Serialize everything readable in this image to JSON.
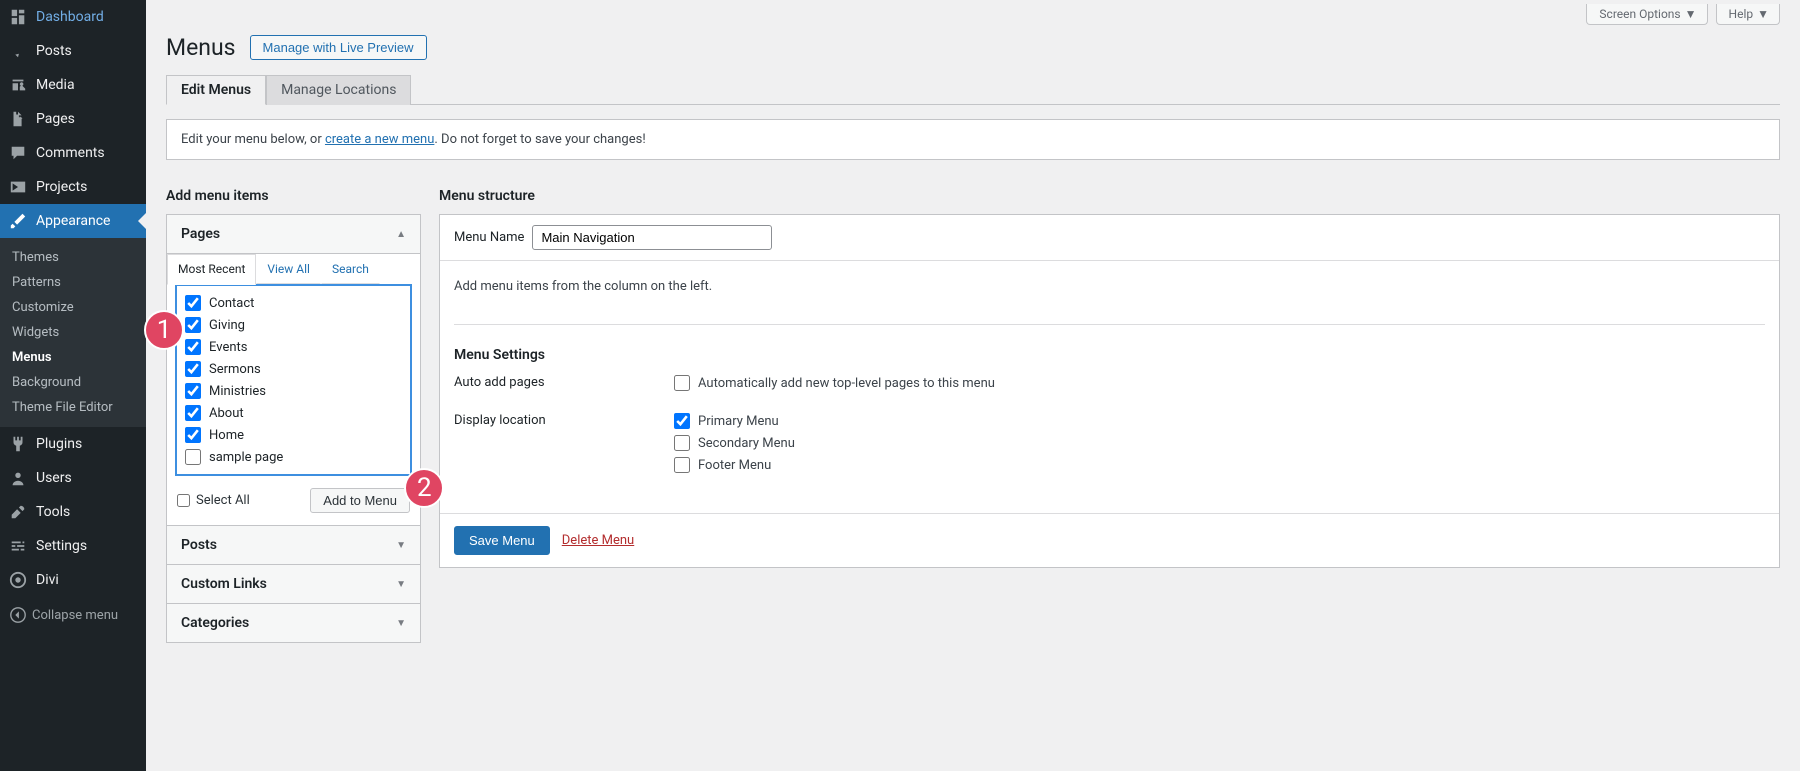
{
  "sidebar": {
    "items": [
      {
        "label": "Dashboard"
      },
      {
        "label": "Posts"
      },
      {
        "label": "Media"
      },
      {
        "label": "Pages"
      },
      {
        "label": "Comments"
      },
      {
        "label": "Projects"
      },
      {
        "label": "Appearance"
      },
      {
        "label": "Plugins"
      },
      {
        "label": "Users"
      },
      {
        "label": "Tools"
      },
      {
        "label": "Settings"
      },
      {
        "label": "Divi"
      }
    ],
    "submenu": [
      {
        "label": "Themes",
        "active": false
      },
      {
        "label": "Patterns",
        "active": false
      },
      {
        "label": "Customize",
        "active": false
      },
      {
        "label": "Widgets",
        "active": false
      },
      {
        "label": "Menus",
        "active": true
      },
      {
        "label": "Background",
        "active": false
      },
      {
        "label": "Theme File Editor",
        "active": false
      }
    ],
    "collapse": "Collapse menu"
  },
  "top": {
    "screen_options": "Screen Options",
    "help": "Help"
  },
  "header": {
    "title": "Menus",
    "live_preview": "Manage with Live Preview"
  },
  "tabs": {
    "edit": "Edit Menus",
    "locations": "Manage Locations"
  },
  "notice": {
    "pre": "Edit your menu below, or ",
    "link": "create a new menu",
    "post": ". Do not forget to save your changes!"
  },
  "add": {
    "heading": "Add menu items",
    "panel_pages": "Pages",
    "sub_tabs": {
      "recent": "Most Recent",
      "all": "View All",
      "search": "Search"
    },
    "pages": [
      {
        "label": "Contact",
        "checked": true
      },
      {
        "label": "Giving",
        "checked": true
      },
      {
        "label": "Events",
        "checked": true
      },
      {
        "label": "Sermons",
        "checked": true
      },
      {
        "label": "Ministries",
        "checked": true
      },
      {
        "label": "About",
        "checked": true
      },
      {
        "label": "Home",
        "checked": true
      },
      {
        "label": "sample page",
        "checked": false
      }
    ],
    "select_all": "Select All",
    "add_btn": "Add to Menu",
    "panel_posts": "Posts",
    "panel_custom": "Custom Links",
    "panel_cats": "Categories"
  },
  "struct": {
    "heading": "Menu structure",
    "name_label": "Menu Name",
    "name_value": "Main Navigation",
    "hint": "Add menu items from the column on the left.",
    "settings_heading": "Menu Settings",
    "auto_label": "Auto add pages",
    "auto_opt": "Automatically add new top-level pages to this menu",
    "loc_label": "Display location",
    "loc_opts": [
      {
        "label": "Primary Menu",
        "checked": true
      },
      {
        "label": "Secondary Menu",
        "checked": false
      },
      {
        "label": "Footer Menu",
        "checked": false
      }
    ],
    "save": "Save Menu",
    "delete": "Delete Menu"
  },
  "badges": {
    "one": "1",
    "two": "2"
  }
}
